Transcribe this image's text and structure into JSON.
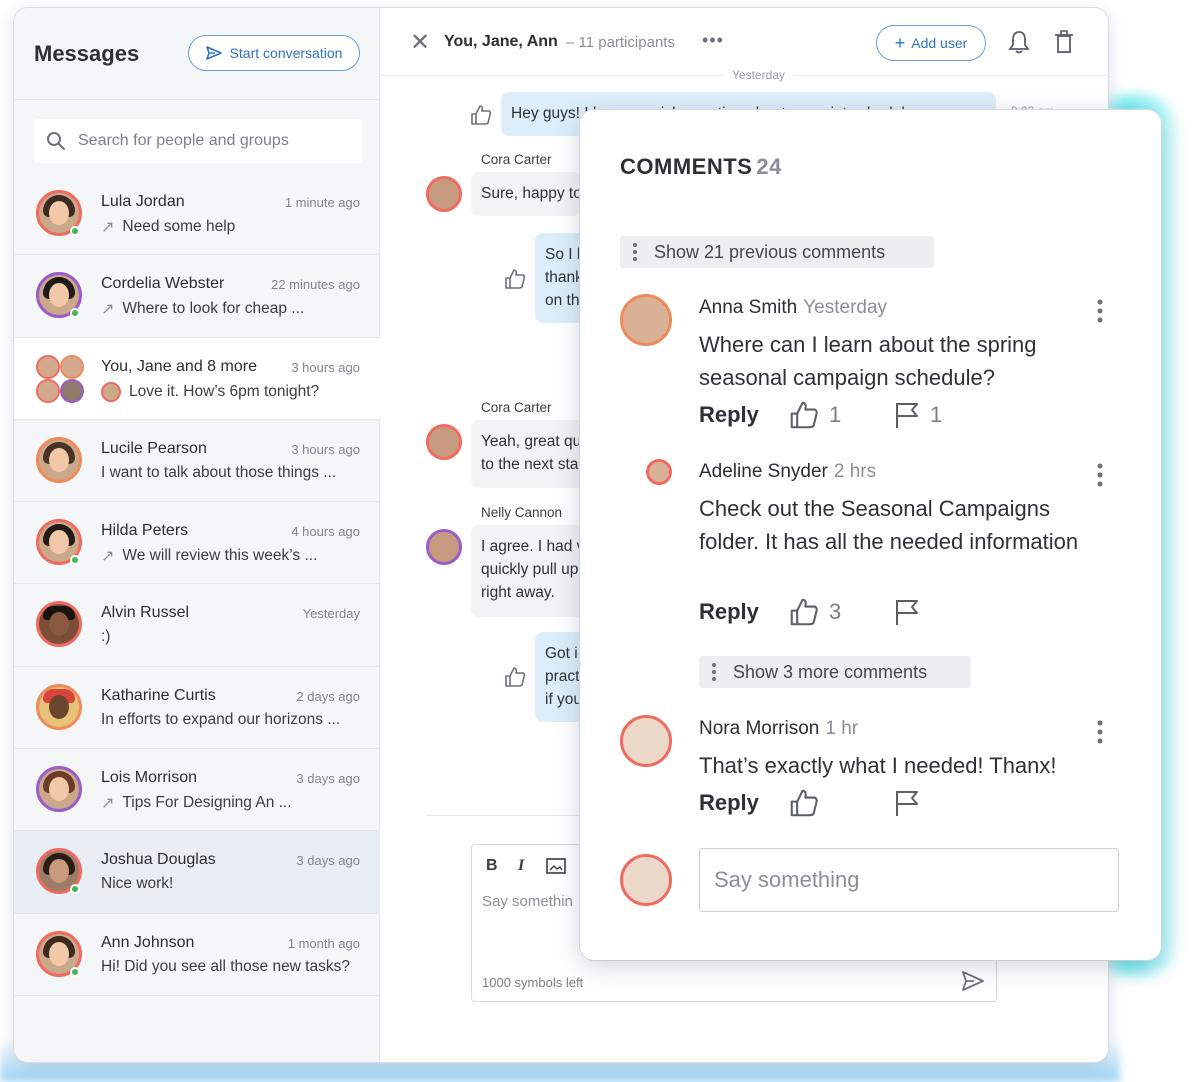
{
  "sidebar": {
    "title": "Messages",
    "start_label": "Start conversation",
    "search_placeholder": "Search for people and groups",
    "conversations": [
      {
        "name": "Lula Jordan",
        "time": "1 minute ago",
        "message": "Need some help",
        "arrow": true
      },
      {
        "name": "Cordelia Webster",
        "time": "22 minutes ago",
        "message": "Where to look for cheap ...",
        "arrow": true
      },
      {
        "name": "You, Jane and 8 more",
        "time": "3 hours ago",
        "message": "Love it. How’s 6pm tonight?",
        "arrow": false
      },
      {
        "name": "Lucile Pearson",
        "time": "3 hours ago",
        "message": "I want to talk about those things ...",
        "arrow": false
      },
      {
        "name": "Hilda Peters",
        "time": "4 hours ago",
        "message": "We will review this week’s ...",
        "arrow": true
      },
      {
        "name": "Alvin Russel",
        "time": "Yesterday",
        "message": ":)",
        "arrow": false
      },
      {
        "name": "Katharine Curtis",
        "time": "2 days ago",
        "message": "In efforts to expand our horizons ...",
        "arrow": false
      },
      {
        "name": "Lois Morrison",
        "time": "3 days ago",
        "message": "Tips For Designing An ...",
        "arrow": true
      },
      {
        "name": "Joshua Douglas",
        "time": "3 days ago",
        "message": "Nice work!",
        "arrow": false
      },
      {
        "name": "Ann Johnson",
        "time": "1 month ago",
        "message": "Hi! Did you see all those new tasks?",
        "arrow": false
      }
    ]
  },
  "chat": {
    "title": "You, Jane, Ann",
    "participants": "– 11 participants",
    "add_user_label": "Add user",
    "day_label": "Yesterday",
    "messages": [
      {
        "sender": "",
        "text": "Hey guys! I have a quick question about our print schedule",
        "time": "9:03 am"
      },
      {
        "sender": "Cora Carter",
        "text": "Sure, happy to"
      },
      {
        "sender": "",
        "text1": "So I h",
        "text2": "thank",
        "text3": "on th"
      },
      {
        "sender": "Cora Carter",
        "text1": "Yeah, great qu",
        "text2": "to the next sta"
      },
      {
        "sender": "Nelly Cannon",
        "text1": "I agree. I had v",
        "text2": "quickly pull up",
        "text3": "right away."
      },
      {
        "sender": "",
        "text1": "Got i",
        "text2": "pract",
        "text3": "if you"
      }
    ],
    "composer_placeholder": "Say somethin",
    "symbols_left": "1000 symbols left"
  },
  "comments": {
    "title": "COMMENTS",
    "count": "24",
    "show_previous": "Show 21 previous comments",
    "show_more": "Show 3 more comments",
    "items": [
      {
        "name": "Anna Smith",
        "when": "Yesterday",
        "text": "Where can I learn about the spring seasonal campaign schedule?",
        "likes": "1",
        "flags": "1"
      },
      {
        "name": "Adeline Snyder",
        "when": "2 hrs",
        "text": "Check out the Seasonal Campaigns folder. It has all the needed information",
        "likes": "3",
        "flags": ""
      },
      {
        "name": "Nora Morrison",
        "when": "1 hr",
        "text": "That’s exactly what I needed! Thanx!",
        "likes": "",
        "flags": ""
      }
    ],
    "reply_label": "Reply",
    "say_placeholder": "Say something"
  },
  "colors": {
    "accent": "#2f73c0",
    "online": "#3fb950",
    "avatar_ring": "#f06a5f",
    "bubble": "#ddeefa"
  }
}
